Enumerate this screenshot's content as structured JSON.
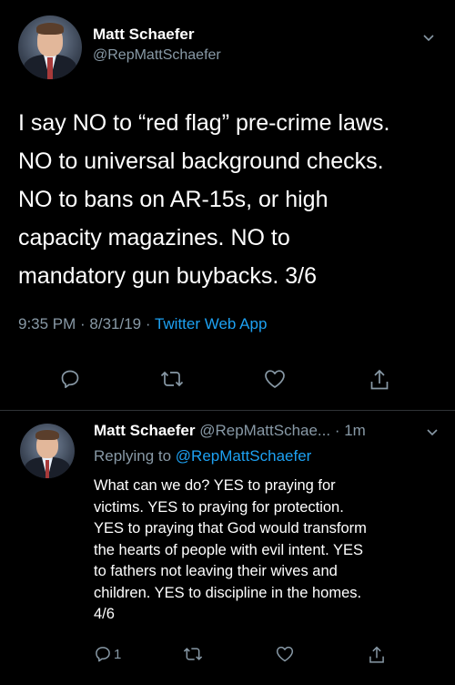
{
  "tweet_main": {
    "author_name": "Matt Schaefer",
    "author_handle": "@RepMattSchaefer",
    "text_lines": [
      "I say NO to “red flag” pre-crime laws.",
      "NO to universal background checks.",
      "NO to bans on AR-15s, or high",
      "capacity magazines. NO to",
      "mandatory gun buybacks.  3/6"
    ],
    "timestamp": "9:35 PM · 8/31/19 · ",
    "source_app": "Twitter Web App",
    "icons": [
      "reply-icon",
      "retweet-icon",
      "like-icon",
      "share-icon",
      "chevron-down-icon"
    ]
  },
  "tweet_reply": {
    "author_name": "Matt Schaefer",
    "author_handle": "@RepMattSchae...",
    "time_ago": "· 1m",
    "replying_prefix": "Replying to ",
    "replying_mention": "@RepMattSchaefer",
    "text_lines": [
      "What can we do? YES to praying for",
      "victims. YES to praying for protection.",
      "YES to praying that God would transform",
      "the hearts of people with evil intent. YES",
      "to fathers not leaving their wives and",
      "children. YES to discipline in the homes.",
      "4/6"
    ],
    "reply_count": "1",
    "icons": [
      "reply-icon",
      "retweet-icon",
      "like-icon",
      "share-icon",
      "chevron-down-icon"
    ]
  },
  "colors": {
    "background": "#000000",
    "text": "#ffffff",
    "secondary": "#8899a6",
    "link": "#1da1f2",
    "divider": "#2f3336"
  }
}
